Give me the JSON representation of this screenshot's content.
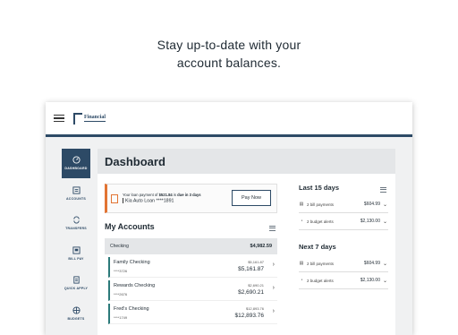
{
  "headline": {
    "line1": "Stay up-to-date with your",
    "line2": "account balances."
  },
  "logo": {
    "text": "Financial"
  },
  "sidebar": {
    "items": [
      {
        "label": "DASHBOARD",
        "icon": "dashboard-icon",
        "active": true
      },
      {
        "label": "ACCOUNTS",
        "icon": "accounts-icon"
      },
      {
        "label": "TRANSFERS",
        "icon": "transfers-icon"
      },
      {
        "label": "BILL PAY",
        "icon": "bill-pay-icon"
      },
      {
        "label": "QUICK APPLY",
        "icon": "quick-apply-icon"
      },
      {
        "label": "BUDGETS",
        "icon": "budgets-icon"
      }
    ]
  },
  "dashboard": {
    "title": "Dashboard"
  },
  "notice": {
    "line1_pre": "Your loan payment of",
    "amount": "$521.84",
    "line1_mid": "is",
    "due": "due in 3 days",
    "loan": "Kia Auto Loan ****1891",
    "pay_label": "Pay Now"
  },
  "accounts": {
    "title": "My Accounts",
    "header_label": "Checking",
    "header_total": "$4,982.59",
    "rows": [
      {
        "name": "Family Checking",
        "number": "****3726",
        "available": "$5,161.87",
        "balance": "$5,161.87"
      },
      {
        "name": "Rewards Checking",
        "number": "****2676",
        "available": "$2,690.21",
        "balance": "$2,690.21"
      },
      {
        "name": "Fred's Checking",
        "number": "****1749",
        "available": "$12,893.76",
        "balance": "$12,893.76"
      }
    ]
  },
  "last15": {
    "title": "Last 15 days",
    "rows": [
      {
        "text": "2 bill payments",
        "amount": "$604.99",
        "icon": "bill-icon"
      },
      {
        "text": "2 budget alerts",
        "amount": "$2,130.00",
        "icon": "budget-alert-icon"
      }
    ]
  },
  "next7": {
    "title": "Next 7 days",
    "rows": [
      {
        "text": "2 bill payments",
        "amount": "$604.99",
        "icon": "bill-icon"
      },
      {
        "text": "2 budget alerts",
        "amount": "$2,130.00",
        "icon": "budget-alert-icon"
      }
    ]
  },
  "colors": {
    "brand": "#2d4a66",
    "alert": "#e27433",
    "accountStripe": "#2b7a7a"
  }
}
